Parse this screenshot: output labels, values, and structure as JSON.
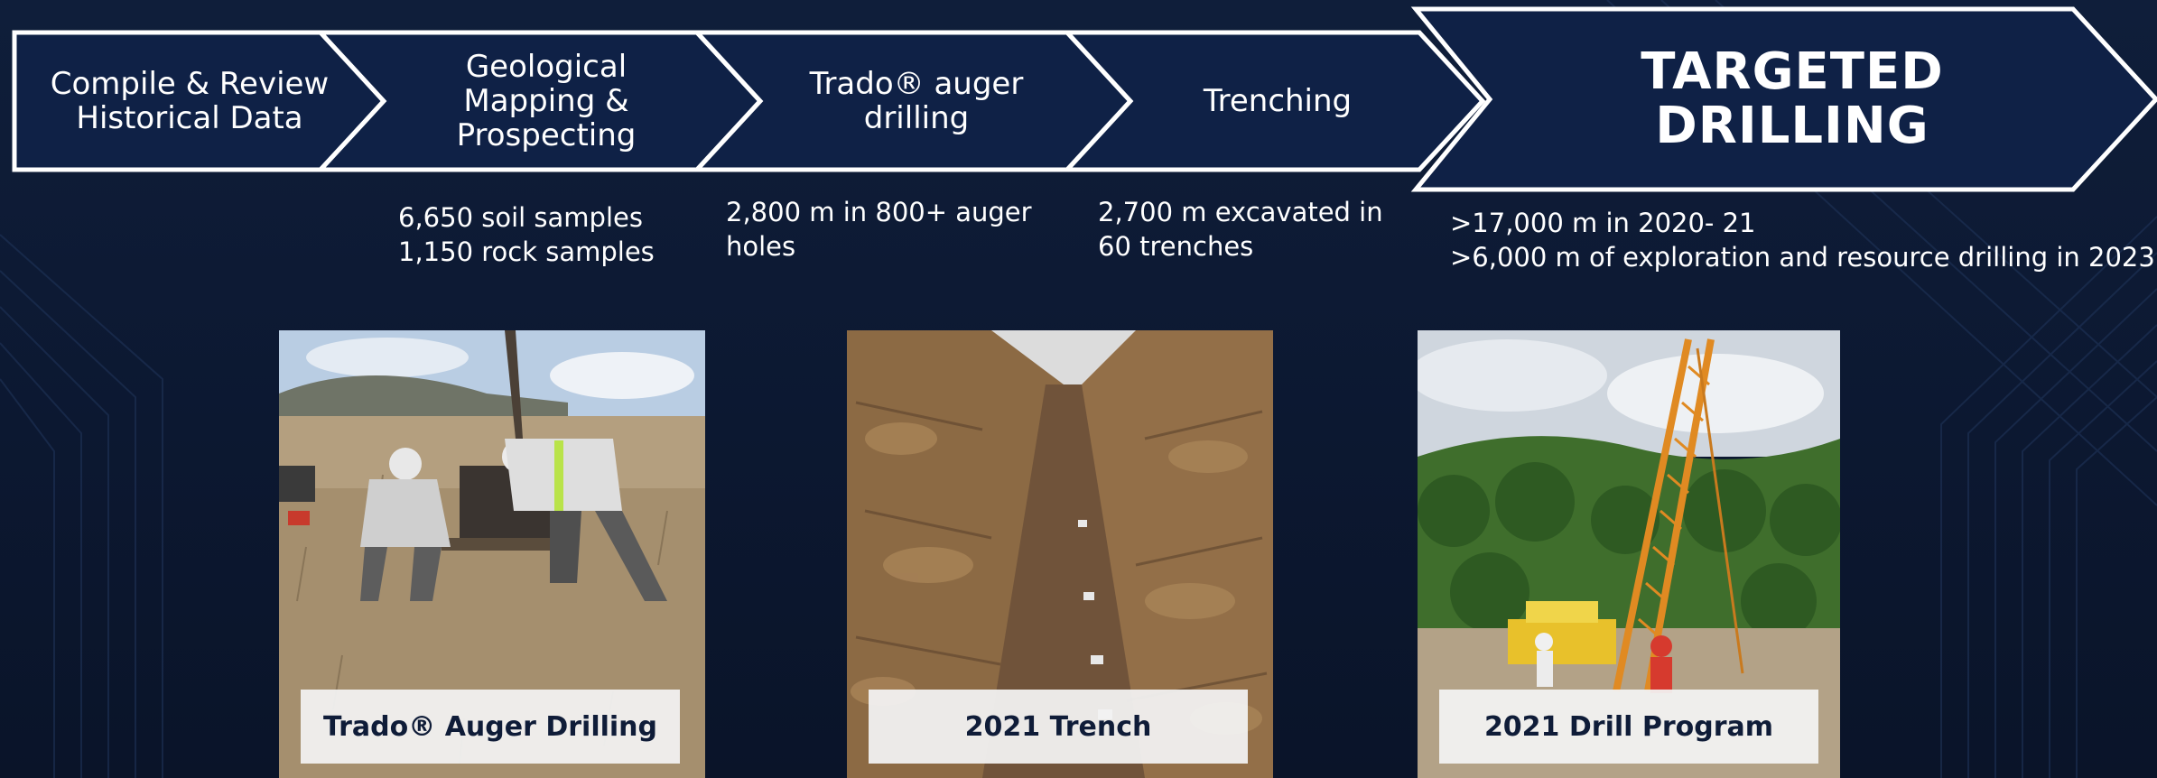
{
  "process": {
    "steps": [
      {
        "label": "Compile & Review\nHistorical Data"
      },
      {
        "label": "Geological\nMapping &\nProspecting"
      },
      {
        "label": "Trado® auger\ndrilling"
      },
      {
        "label": "Trenching"
      },
      {
        "label": "TARGETED DRILLING"
      }
    ]
  },
  "stats": {
    "mapping": "6,650 soil samples\n1,150 rock samples",
    "auger": "2,800 m in 800+ auger\nholes",
    "trenching": "2,700 m excavated in\n60 trenches",
    "drilling": ">17,000 m in 2020- 21\n>6,000 m of exploration and resource drilling in 2023"
  },
  "photos": [
    {
      "caption": "Trado® Auger Drilling",
      "icon": "auger-drilling-photo"
    },
    {
      "caption": "2021 Trench",
      "icon": "trench-photo"
    },
    {
      "caption": "2021 Drill Program",
      "icon": "drill-rig-photo"
    }
  ],
  "colors": {
    "background": "#0c1831",
    "chevron_fill": "#0f2146",
    "chevron_stroke": "#ffffff",
    "caption_bg": "#f2f2f2",
    "caption_text": "#0f1c38"
  }
}
